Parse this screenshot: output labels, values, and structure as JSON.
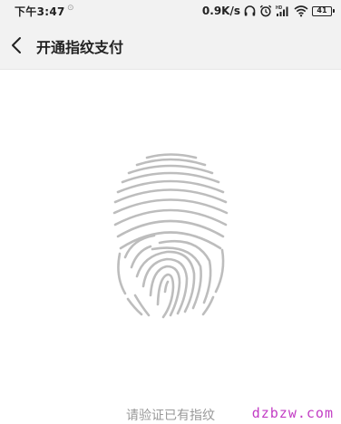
{
  "status_bar": {
    "time": "下午3:47",
    "small_indicator": "⊙",
    "network_speed": "0.9K/s",
    "icons": [
      "headphones-icon",
      "alarm-icon",
      "hd-signal-icon",
      "wifi-icon"
    ],
    "battery_level": "41"
  },
  "header": {
    "back_icon": "chevron-left-icon",
    "title": "开通指纹支付"
  },
  "main": {
    "fingerprint_icon": "fingerprint-icon",
    "fingerprint_color": "#bdbdbd",
    "prompt": "请验证已有指纹"
  },
  "watermark": {
    "text": "dzbzw.com",
    "color": "#c23cc4"
  }
}
